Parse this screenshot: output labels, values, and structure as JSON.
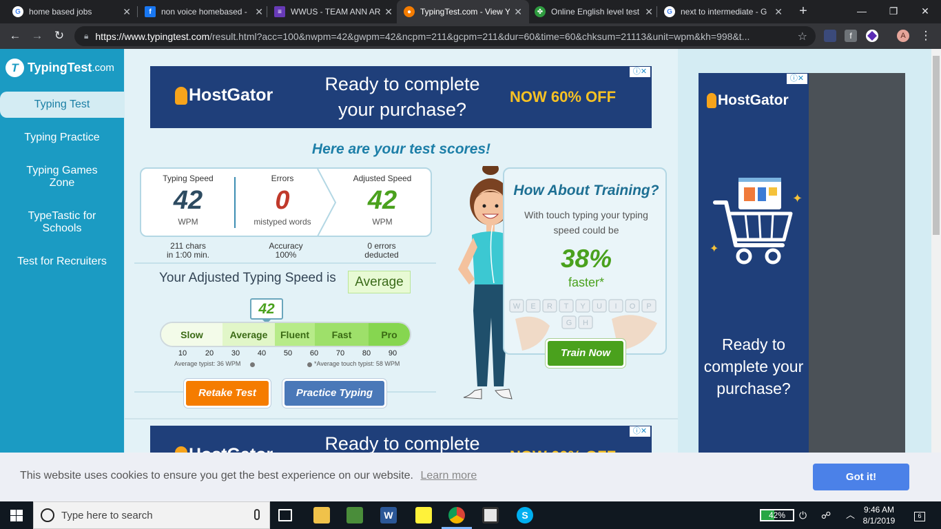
{
  "browser": {
    "tabs": [
      {
        "title": "home based jobs",
        "favicon": "google-icon",
        "color": "#ffffff",
        "active": false
      },
      {
        "title": "non voice homebased -",
        "favicon": "facebook-icon",
        "color": "#1877f2",
        "active": false
      },
      {
        "title": "WWUS - TEAM ANN AR",
        "favicon": "forms-icon",
        "color": "#673ab7",
        "active": false
      },
      {
        "title": "TypingTest.com - View Y",
        "favicon": "typingtest-icon",
        "color": "#f57c00",
        "active": true
      },
      {
        "title": "Online English level test",
        "favicon": "clover-icon",
        "color": "#2e9b3f",
        "active": false
      },
      {
        "title": "next to intermediate - G",
        "favicon": "google-icon",
        "color": "#ffffff",
        "active": false
      }
    ],
    "url_host": "https://www.typingtest.com",
    "url_rest": "/result.html?acc=100&nwpm=42&gwpm=42&ncpm=211&gcpm=211&dur=60&time=60&chksum=21113&unit=wpm&kh=998&t...",
    "profile_initial": "A"
  },
  "site": {
    "logo_name": "TypingTest",
    "logo_domain": ".com",
    "logo_mark": "T",
    "nav": [
      "Typing Test",
      "Typing Practice",
      "Typing Games Zone",
      "TypeTastic for Schools",
      "Test for Recruiters"
    ]
  },
  "ads": {
    "brand": "HostGator",
    "message": "Ready to complete your purchase?",
    "cta": "NOW 60% OFF",
    "side_message": "Ready to complete your purchase?"
  },
  "results": {
    "heading": "Here are your test scores!",
    "typing_speed": {
      "label": "Typing Speed",
      "value": "42",
      "unit": "WPM",
      "sub1": "211 chars",
      "sub2": "in 1:00 min."
    },
    "errors": {
      "label": "Errors",
      "value": "0",
      "unit": "mistyped words",
      "sub1": "Accuracy",
      "sub2": "100%"
    },
    "adjusted_speed": {
      "label": "Adjusted Speed",
      "value": "42",
      "unit": "WPM",
      "sub1": "0 errors",
      "sub2": "deducted"
    },
    "adjusted_text": "Your Adjusted Typing Speed is",
    "adjusted_level": "Average",
    "meter_value": "42",
    "meter_segments": [
      "Slow",
      "Average",
      "Fluent",
      "Fast",
      "Pro"
    ],
    "meter_ticks": [
      "10",
      "20",
      "30",
      "40",
      "50",
      "60",
      "70",
      "80",
      "90"
    ],
    "average_typist": "Average typist: 36 WPM",
    "average_touch": "*Average touch typist: 58 WPM",
    "retake": "Retake Test",
    "practice": "Practice Typing"
  },
  "training": {
    "title": "How About Training?",
    "text": "With touch typing your typing speed could be",
    "percent": "38%",
    "faster": "faster*",
    "button": "Train Now",
    "keys": [
      "W",
      "E",
      "R",
      "T",
      "Y",
      "U",
      "I",
      "O",
      "P",
      "G",
      "H"
    ]
  },
  "cookie": {
    "message": "This website uses cookies to ensure you get the best experience on our website.",
    "learn_more": "Learn more",
    "button": "Got it!"
  },
  "taskbar": {
    "search_placeholder": "Type here to search",
    "battery": "42%",
    "battery_level": 0.42,
    "time": "9:46 AM",
    "date": "8/1/2019",
    "notifications": "6"
  },
  "colors": {
    "sidebar": "#1b9bc3",
    "ad_blue": "#1f3f7a",
    "green": "#4aa11d",
    "error_red": "#c0392b",
    "retake": "#f57c00",
    "practice": "#4a78b8"
  }
}
